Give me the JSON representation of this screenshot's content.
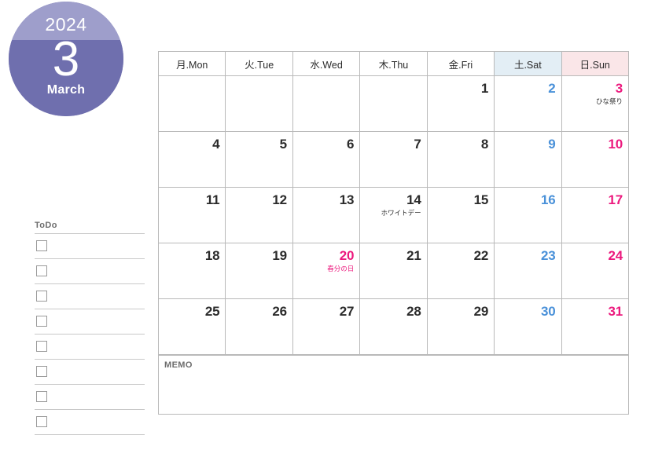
{
  "badge": {
    "year": "2024",
    "month_number": "3",
    "month_name": "March",
    "top_color": "#9e9ecb",
    "bottom_color": "#6f6fae"
  },
  "weekday_headers": [
    {
      "label": "月.Mon",
      "kind": "weekday"
    },
    {
      "label": "火.Tue",
      "kind": "weekday"
    },
    {
      "label": "水.Wed",
      "kind": "weekday"
    },
    {
      "label": "木.Thu",
      "kind": "weekday"
    },
    {
      "label": "金.Fri",
      "kind": "weekday"
    },
    {
      "label": "土.Sat",
      "kind": "saturday"
    },
    {
      "label": "日.Sun",
      "kind": "sunday"
    }
  ],
  "weeks": [
    [
      {
        "num": "",
        "event": ""
      },
      {
        "num": "",
        "event": ""
      },
      {
        "num": "",
        "event": ""
      },
      {
        "num": "",
        "event": ""
      },
      {
        "num": "1",
        "event": ""
      },
      {
        "num": "2",
        "event": ""
      },
      {
        "num": "3",
        "event": "ひな祭り"
      }
    ],
    [
      {
        "num": "4",
        "event": ""
      },
      {
        "num": "5",
        "event": ""
      },
      {
        "num": "6",
        "event": ""
      },
      {
        "num": "7",
        "event": ""
      },
      {
        "num": "8",
        "event": ""
      },
      {
        "num": "9",
        "event": ""
      },
      {
        "num": "10",
        "event": ""
      }
    ],
    [
      {
        "num": "11",
        "event": ""
      },
      {
        "num": "12",
        "event": ""
      },
      {
        "num": "13",
        "event": ""
      },
      {
        "num": "14",
        "event": "ホワイトデー"
      },
      {
        "num": "15",
        "event": ""
      },
      {
        "num": "16",
        "event": ""
      },
      {
        "num": "17",
        "event": ""
      }
    ],
    [
      {
        "num": "18",
        "event": ""
      },
      {
        "num": "19",
        "event": ""
      },
      {
        "num": "20",
        "event": "春分の日",
        "holiday": true
      },
      {
        "num": "21",
        "event": ""
      },
      {
        "num": "22",
        "event": ""
      },
      {
        "num": "23",
        "event": ""
      },
      {
        "num": "24",
        "event": ""
      }
    ],
    [
      {
        "num": "25",
        "event": ""
      },
      {
        "num": "26",
        "event": ""
      },
      {
        "num": "27",
        "event": ""
      },
      {
        "num": "28",
        "event": ""
      },
      {
        "num": "29",
        "event": ""
      },
      {
        "num": "30",
        "event": ""
      },
      {
        "num": "31",
        "event": ""
      }
    ]
  ],
  "todo": {
    "title": "ToDo",
    "rows": 8
  },
  "memo": {
    "label": "MEMO"
  },
  "colors": {
    "saturday": "#4a91d9",
    "sunday": "#ec1a7e",
    "holiday": "#ec1a7e",
    "saturday_header_bg": "#e3eef5",
    "sunday_header_bg": "#fae6e8",
    "grid_line": "#b9b9b9",
    "rule_line": "#c9c9c9"
  }
}
